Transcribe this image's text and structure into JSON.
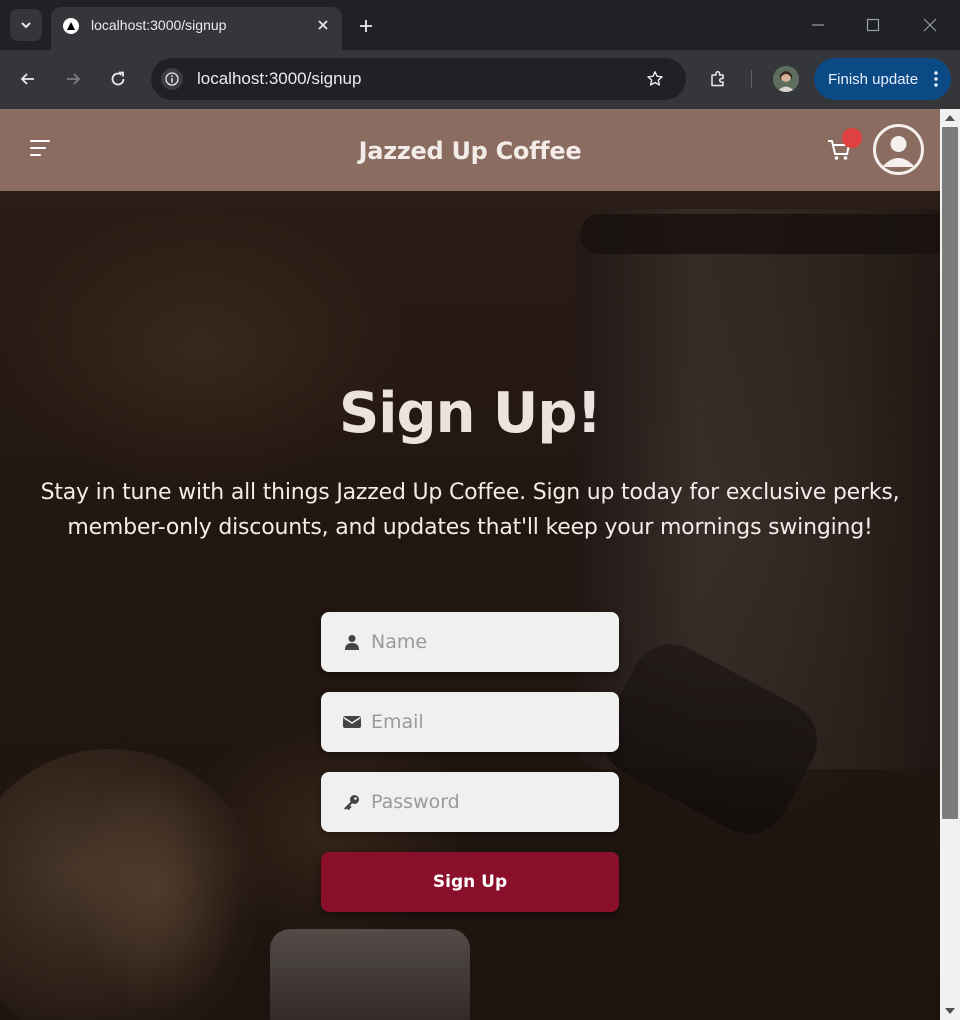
{
  "browser": {
    "tab": {
      "title": "localhost:3000/signup"
    },
    "address": {
      "url": "localhost:3000/signup"
    },
    "update_button_label": "Finish update"
  },
  "icons": {
    "tab_search": "chevron-down-icon",
    "favicon": "triangle-logo-icon",
    "tab_close": "close-icon",
    "new_tab": "plus-icon",
    "back": "arrow-left-icon",
    "forward": "arrow-right-icon",
    "reload": "reload-icon",
    "site_info": "info-icon",
    "bookmark": "star-icon",
    "extensions": "puzzle-icon",
    "menu": "hamburger-icon",
    "cart": "cart-icon",
    "account": "user-circle-icon",
    "name": "person-icon",
    "email": "envelope-icon",
    "password": "key-icon"
  },
  "app": {
    "brand": "Jazzed Up Coffee"
  },
  "signup": {
    "heading": "Sign Up!",
    "subtext": "Stay in tune with all things Jazzed Up Coffee. Sign up today for exclusive perks, member-only discounts, and updates that'll keep your mornings swinging!",
    "name_placeholder": "Name",
    "email_placeholder": "Email",
    "password_placeholder": "Password",
    "submit_label": "Sign Up"
  },
  "colors": {
    "header": "#8b6c60",
    "submit": "#8a0f2a",
    "cart_badge": "#e0403f",
    "update_button": "#0b4a85"
  }
}
